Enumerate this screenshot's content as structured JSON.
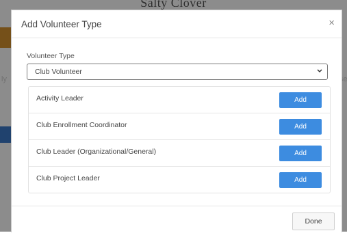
{
  "background": {
    "title": "Salty Clover",
    "fragments": [
      "ly",
      "se"
    ]
  },
  "modal": {
    "title": "Add Volunteer Type",
    "close_icon": "×",
    "field_label": "Volunteer Type",
    "select_value": "Club Volunteer",
    "items": [
      {
        "label": "Activity Leader",
        "button": "Add"
      },
      {
        "label": "Club Enrollment Coordinator",
        "button": "Add"
      },
      {
        "label": "Club Leader (Organizational/General)",
        "button": "Add"
      },
      {
        "label": "Club Project Leader",
        "button": "Add"
      }
    ],
    "done_label": "Done"
  },
  "colors": {
    "primary": "#3d8ce0",
    "overlay": "#000000"
  }
}
